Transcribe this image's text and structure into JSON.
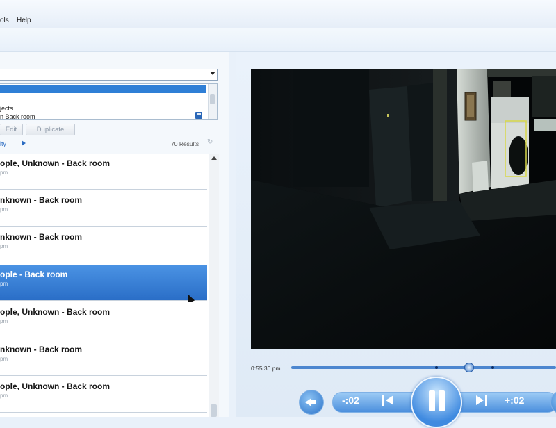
{
  "menu": {
    "tools_label": "ols",
    "help_label": "Help"
  },
  "filters": {
    "line1": "jects",
    "line2": "n Back room"
  },
  "buttons": {
    "edit": "Edit",
    "duplicate": "Duplicate"
  },
  "play_by": {
    "label": "ity"
  },
  "results": {
    "count_label": "70 Results"
  },
  "events": [
    {
      "title": "ople, Unknown - Back room",
      "time": "pm",
      "selected": false
    },
    {
      "title": "nknown - Back room",
      "time": "pm",
      "selected": false
    },
    {
      "title": "nknown - Back room",
      "time": "pm",
      "selected": false
    },
    {
      "title": "ople - Back room",
      "time": "pm",
      "selected": true
    },
    {
      "title": "ople, Unknown - Back room",
      "time": "pm",
      "selected": false
    },
    {
      "title": "nknown - Back room",
      "time": "pm",
      "selected": false
    },
    {
      "title": "ople, Unknown - Back room",
      "time": "pm",
      "selected": false
    }
  ],
  "player": {
    "timestamp": "0:55:30 pm",
    "skip_back": "-:02",
    "skip_forward": "+:02"
  },
  "colors": {
    "accent": "#2f7fd6",
    "selected_row": "#3a82d6",
    "detection_box": "#d8d84a"
  }
}
